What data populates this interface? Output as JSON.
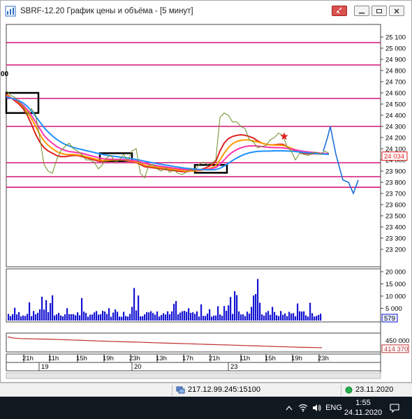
{
  "window": {
    "title": "SBRF-12.20 График цены и объёма - [5 минут]",
    "buttons": [
      "link-icon",
      "minimize-icon",
      "restore-icon",
      "close-icon"
    ]
  },
  "chart_data": {
    "type": "line",
    "title": "",
    "price_axis": {
      "ticks": [
        "25 100",
        "25 000",
        "24 900",
        "24 800",
        "24 700",
        "24 600",
        "24 500",
        "24 400",
        "24 300",
        "24 200",
        "24 100",
        "24 000",
        "23 900",
        "23 800",
        "23 700",
        "23 600",
        "23 500",
        "23 400",
        "23 300",
        "23 200"
      ],
      "ylim": [
        23150,
        25150
      ],
      "current_label": "24 034",
      "current_value": 24034
    },
    "left_stray_label": "00",
    "horizontal_levels": [
      25050,
      24850,
      24550,
      24300,
      23975,
      23850,
      23755
    ],
    "volume_axis": {
      "ticks": [
        "20 000",
        "15 000",
        "10 000",
        "5 000"
      ],
      "current_label": "579"
    },
    "oi_axis": {
      "ticks": [
        "450 000"
      ],
      "current_label": "414 370"
    },
    "time_labels": [
      "21h",
      "11h",
      "15h",
      "19h",
      "23h",
      "13h",
      "17h",
      "21h",
      "11h",
      "15h",
      "19h",
      "23h"
    ],
    "day_labels": [
      "19",
      "20",
      "23"
    ],
    "price_x": [
      0,
      6,
      12,
      18,
      24,
      30,
      36,
      42,
      48,
      54,
      60,
      66,
      72,
      78,
      84,
      90,
      96,
      102,
      108,
      114,
      120,
      126,
      132,
      138,
      144,
      150,
      156,
      162,
      168,
      174,
      180,
      186,
      192,
      198,
      204,
      210,
      216,
      222,
      228,
      234,
      240,
      246,
      252,
      258,
      264,
      270,
      276,
      282,
      288,
      294,
      300,
      306,
      312,
      318,
      324,
      330,
      336,
      342,
      348,
      354,
      360,
      366,
      372,
      378,
      384,
      390,
      396,
      402,
      408,
      414,
      420,
      426,
      432,
      438,
      444,
      450,
      456,
      462
    ],
    "price_values": [
      24620,
      24580,
      24560,
      24520,
      24480,
      24400,
      24460,
      24400,
      24200,
      23960,
      23900,
      23880,
      24000,
      24080,
      24120,
      24150,
      24100,
      24080,
      24050,
      24000,
      24000,
      23980,
      23920,
      23960,
      24020,
      24040,
      23980,
      24000,
      24050,
      23990,
      24080,
      24100,
      23880,
      23840,
      23950,
      23960,
      23920,
      23900,
      23930,
      23890,
      23910,
      23880,
      23870,
      23890,
      23920,
      23900,
      23960,
      23980,
      23960,
      23970,
      24000,
      24380,
      24420,
      24400,
      24340,
      24340,
      24300,
      24280,
      24180,
      24160,
      24110,
      24120,
      24130,
      24180,
      24200,
      24240,
      24220,
      24120,
      24080,
      24000,
      24060,
      24050,
      24040,
      24060,
      24070,
      24050,
      24080,
      24060
    ],
    "ma_series": [
      {
        "color": "#e02020",
        "values": [
          24590,
          24560,
          24530,
          24500,
          24460,
          24400,
          24320,
          24230,
          24160,
          24110,
          24080,
          24060,
          24040,
          24030,
          24030,
          24035,
          24040,
          24040,
          24030,
          24020,
          24010,
          24000,
          23990,
          23990,
          23995,
          24000,
          24000,
          24005,
          24000,
          23990,
          23985,
          23975,
          23960,
          23940,
          23935,
          23930,
          23925,
          23920,
          23915,
          23910,
          23905,
          23900,
          23895,
          23895,
          23900,
          23905,
          23910,
          23920,
          23935,
          23955,
          23985,
          24080,
          24150,
          24190,
          24210,
          24220,
          24225,
          24220,
          24210,
          24195,
          24170,
          24150,
          24140,
          24135,
          24135,
          24140,
          24140,
          24120,
          24100,
          24080,
          24070,
          24060,
          24055,
          24055,
          24055,
          24055,
          24055,
          24050
        ]
      },
      {
        "color": "#ff9900",
        "values": [
          24580,
          24560,
          24540,
          24515,
          24480,
          24430,
          24370,
          24300,
          24230,
          24170,
          24130,
          24100,
          24075,
          24060,
          24050,
          24048,
          24048,
          24045,
          24040,
          24030,
          24020,
          24010,
          24000,
          23995,
          23995,
          23998,
          24000,
          24000,
          24000,
          23995,
          23990,
          23980,
          23970,
          23955,
          23945,
          23940,
          23935,
          23930,
          23925,
          23920,
          23915,
          23910,
          23905,
          23900,
          23900,
          23902,
          23905,
          23910,
          23918,
          23930,
          23950,
          24000,
          24060,
          24110,
          24145,
          24165,
          24175,
          24180,
          24178,
          24170,
          24160,
          24150,
          24140,
          24135,
          24133,
          24133,
          24130,
          24120,
          24105,
          24090,
          24080,
          24070,
          24065,
          24060,
          24058,
          24056,
          24055,
          24052
        ]
      },
      {
        "color": "#ff33aa",
        "values": [
          24570,
          24555,
          24540,
          24520,
          24490,
          24450,
          24400,
          24340,
          24280,
          24220,
          24180,
          24150,
          24120,
          24100,
          24085,
          24075,
          24070,
          24065,
          24060,
          24050,
          24040,
          24030,
          24020,
          24012,
          24008,
          24006,
          24005,
          24005,
          24004,
          24000,
          23995,
          23990,
          23982,
          23972,
          23962,
          23955,
          23948,
          23942,
          23937,
          23932,
          23927,
          23922,
          23917,
          23913,
          23911,
          23910,
          23910,
          23912,
          23916,
          23922,
          23932,
          23960,
          24000,
          24040,
          24070,
          24092,
          24108,
          24120,
          24125,
          24126,
          24124,
          24120,
          24115,
          24112,
          24110,
          24110,
          24108,
          24103,
          24097,
          24090,
          24083,
          24077,
          24072,
          24068,
          24064,
          24060,
          24058,
          24056
        ]
      },
      {
        "color": "#1e90ff",
        "values": [
          24560,
          24555,
          24545,
          24530,
          24510,
          24480,
          24440,
          24390,
          24340,
          24290,
          24250,
          24215,
          24185,
          24160,
          24140,
          24125,
          24112,
          24102,
          24093,
          24084,
          24075,
          24066,
          24057,
          24049,
          24042,
          24036,
          24031,
          24026,
          24021,
          24016,
          24010,
          24004,
          23997,
          23989,
          23981,
          23974,
          23967,
          23960,
          23954,
          23948,
          23942,
          23936,
          23930,
          23925,
          23921,
          23918,
          23915,
          23913,
          23912,
          23912,
          23913,
          23925,
          23945,
          23970,
          23995,
          24017,
          24036,
          24052,
          24063,
          24071,
          24076,
          24078,
          24079,
          24080,
          24081,
          24081,
          24081,
          24080,
          24078,
          24075,
          24071,
          24067,
          24063,
          24060,
          24057,
          24054,
          24052,
          24050
        ]
      }
    ],
    "forecast_line": {
      "color": "#1e6fd9",
      "x": [
        462,
        468,
        472,
        480,
        490,
        498,
        505,
        512
      ],
      "values": [
        24080,
        24200,
        24300,
        24050,
        23820,
        23800,
        23700,
        23820
      ]
    },
    "markers": {
      "star_x": 398,
      "star_value": 24210
    },
    "boxes": [
      {
        "x": [
          8,
          54
        ],
        "values": [
          24600,
          24420
        ]
      },
      {
        "x": [
          142,
          188
        ],
        "values": [
          24060,
          23990
        ]
      },
      {
        "x": [
          278,
          324
        ],
        "values": [
          23955,
          23885
        ]
      }
    ],
    "volume_x_count": 150,
    "oi_values": [
      468000,
      462000,
      460000,
      459000,
      458000,
      457500,
      457000,
      456000,
      455000,
      454000,
      453000,
      452000,
      450500,
      449000,
      448000,
      447000,
      446000,
      445000,
      444000,
      443000,
      442000,
      441000,
      440000,
      439000,
      438000,
      437000,
      436000,
      435000,
      434000,
      433000,
      432000,
      431000,
      430000,
      429000,
      428000,
      427000,
      426000,
      425000,
      424000,
      423000,
      422000,
      421000,
      420000,
      419000,
      418000,
      417000,
      416000,
      415500,
      415000,
      414370
    ]
  },
  "statusbar": {
    "server": "217.12.99.245:15100",
    "date": "23.11.2020"
  },
  "taskbar": {
    "lang": "ENG",
    "time": "1:55",
    "date": "24.11.2020"
  },
  "colors": {
    "level_line": "#d4147a",
    "price_line": "#6b8e23",
    "volume_fill": "#1414d2",
    "volume_tag": "#e6eeff"
  }
}
